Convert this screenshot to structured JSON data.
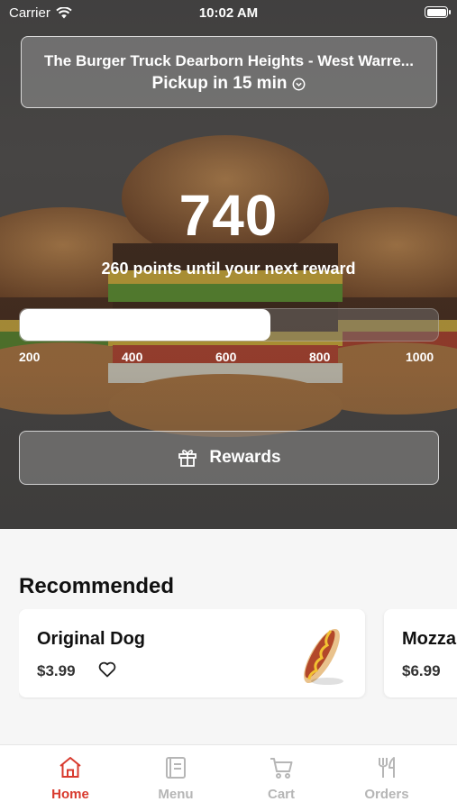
{
  "status_bar": {
    "carrier": "Carrier",
    "time": "10:02 AM"
  },
  "store": {
    "name": "The Burger Truck Dearborn Heights - West Warre...",
    "pickup": "Pickup in 15 min"
  },
  "loyalty": {
    "points": "740",
    "until_next": "260 points until your next reward",
    "progress_fraction": 0.6,
    "ticks": [
      "200",
      "400",
      "600",
      "800",
      "1000"
    ],
    "rewards_label": "Rewards"
  },
  "recommended": {
    "title": "Recommended",
    "items": [
      {
        "name": "Original Dog",
        "price": "$3.99"
      },
      {
        "name": "Mozza",
        "price": "$6.99"
      }
    ]
  },
  "tabs": [
    {
      "label": "Home",
      "icon": "home-icon",
      "active": true
    },
    {
      "label": "Menu",
      "icon": "menu-icon",
      "active": false
    },
    {
      "label": "Cart",
      "icon": "cart-icon",
      "active": false
    },
    {
      "label": "Orders",
      "icon": "orders-icon",
      "active": false
    }
  ],
  "colors": {
    "accent": "#d83a2e",
    "inactive_tab": "#b6b6b6"
  }
}
